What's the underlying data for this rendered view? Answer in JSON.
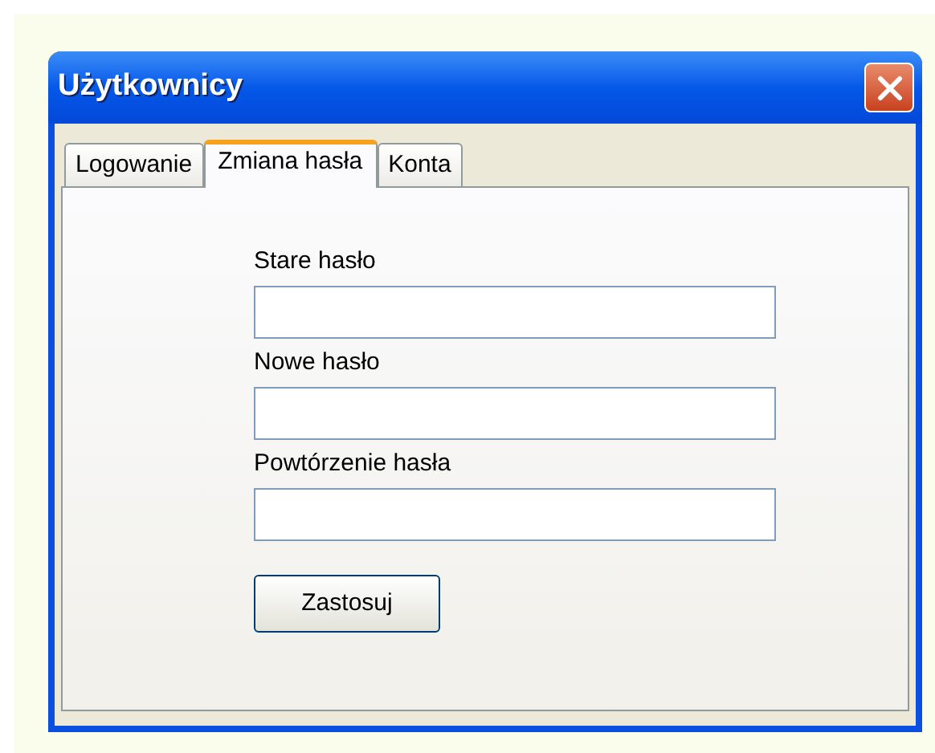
{
  "window": {
    "title": "Użytkownicy"
  },
  "tabs": [
    {
      "label": "Logowanie",
      "selected": false
    },
    {
      "label": "Zmiana hasła",
      "selected": true
    },
    {
      "label": "Konta",
      "selected": false
    }
  ],
  "fields": [
    {
      "label": "Stare hasło"
    },
    {
      "label": "Nowe hasło"
    },
    {
      "label": "Powtórzenie hasła"
    }
  ],
  "button": "Zastosuj"
}
